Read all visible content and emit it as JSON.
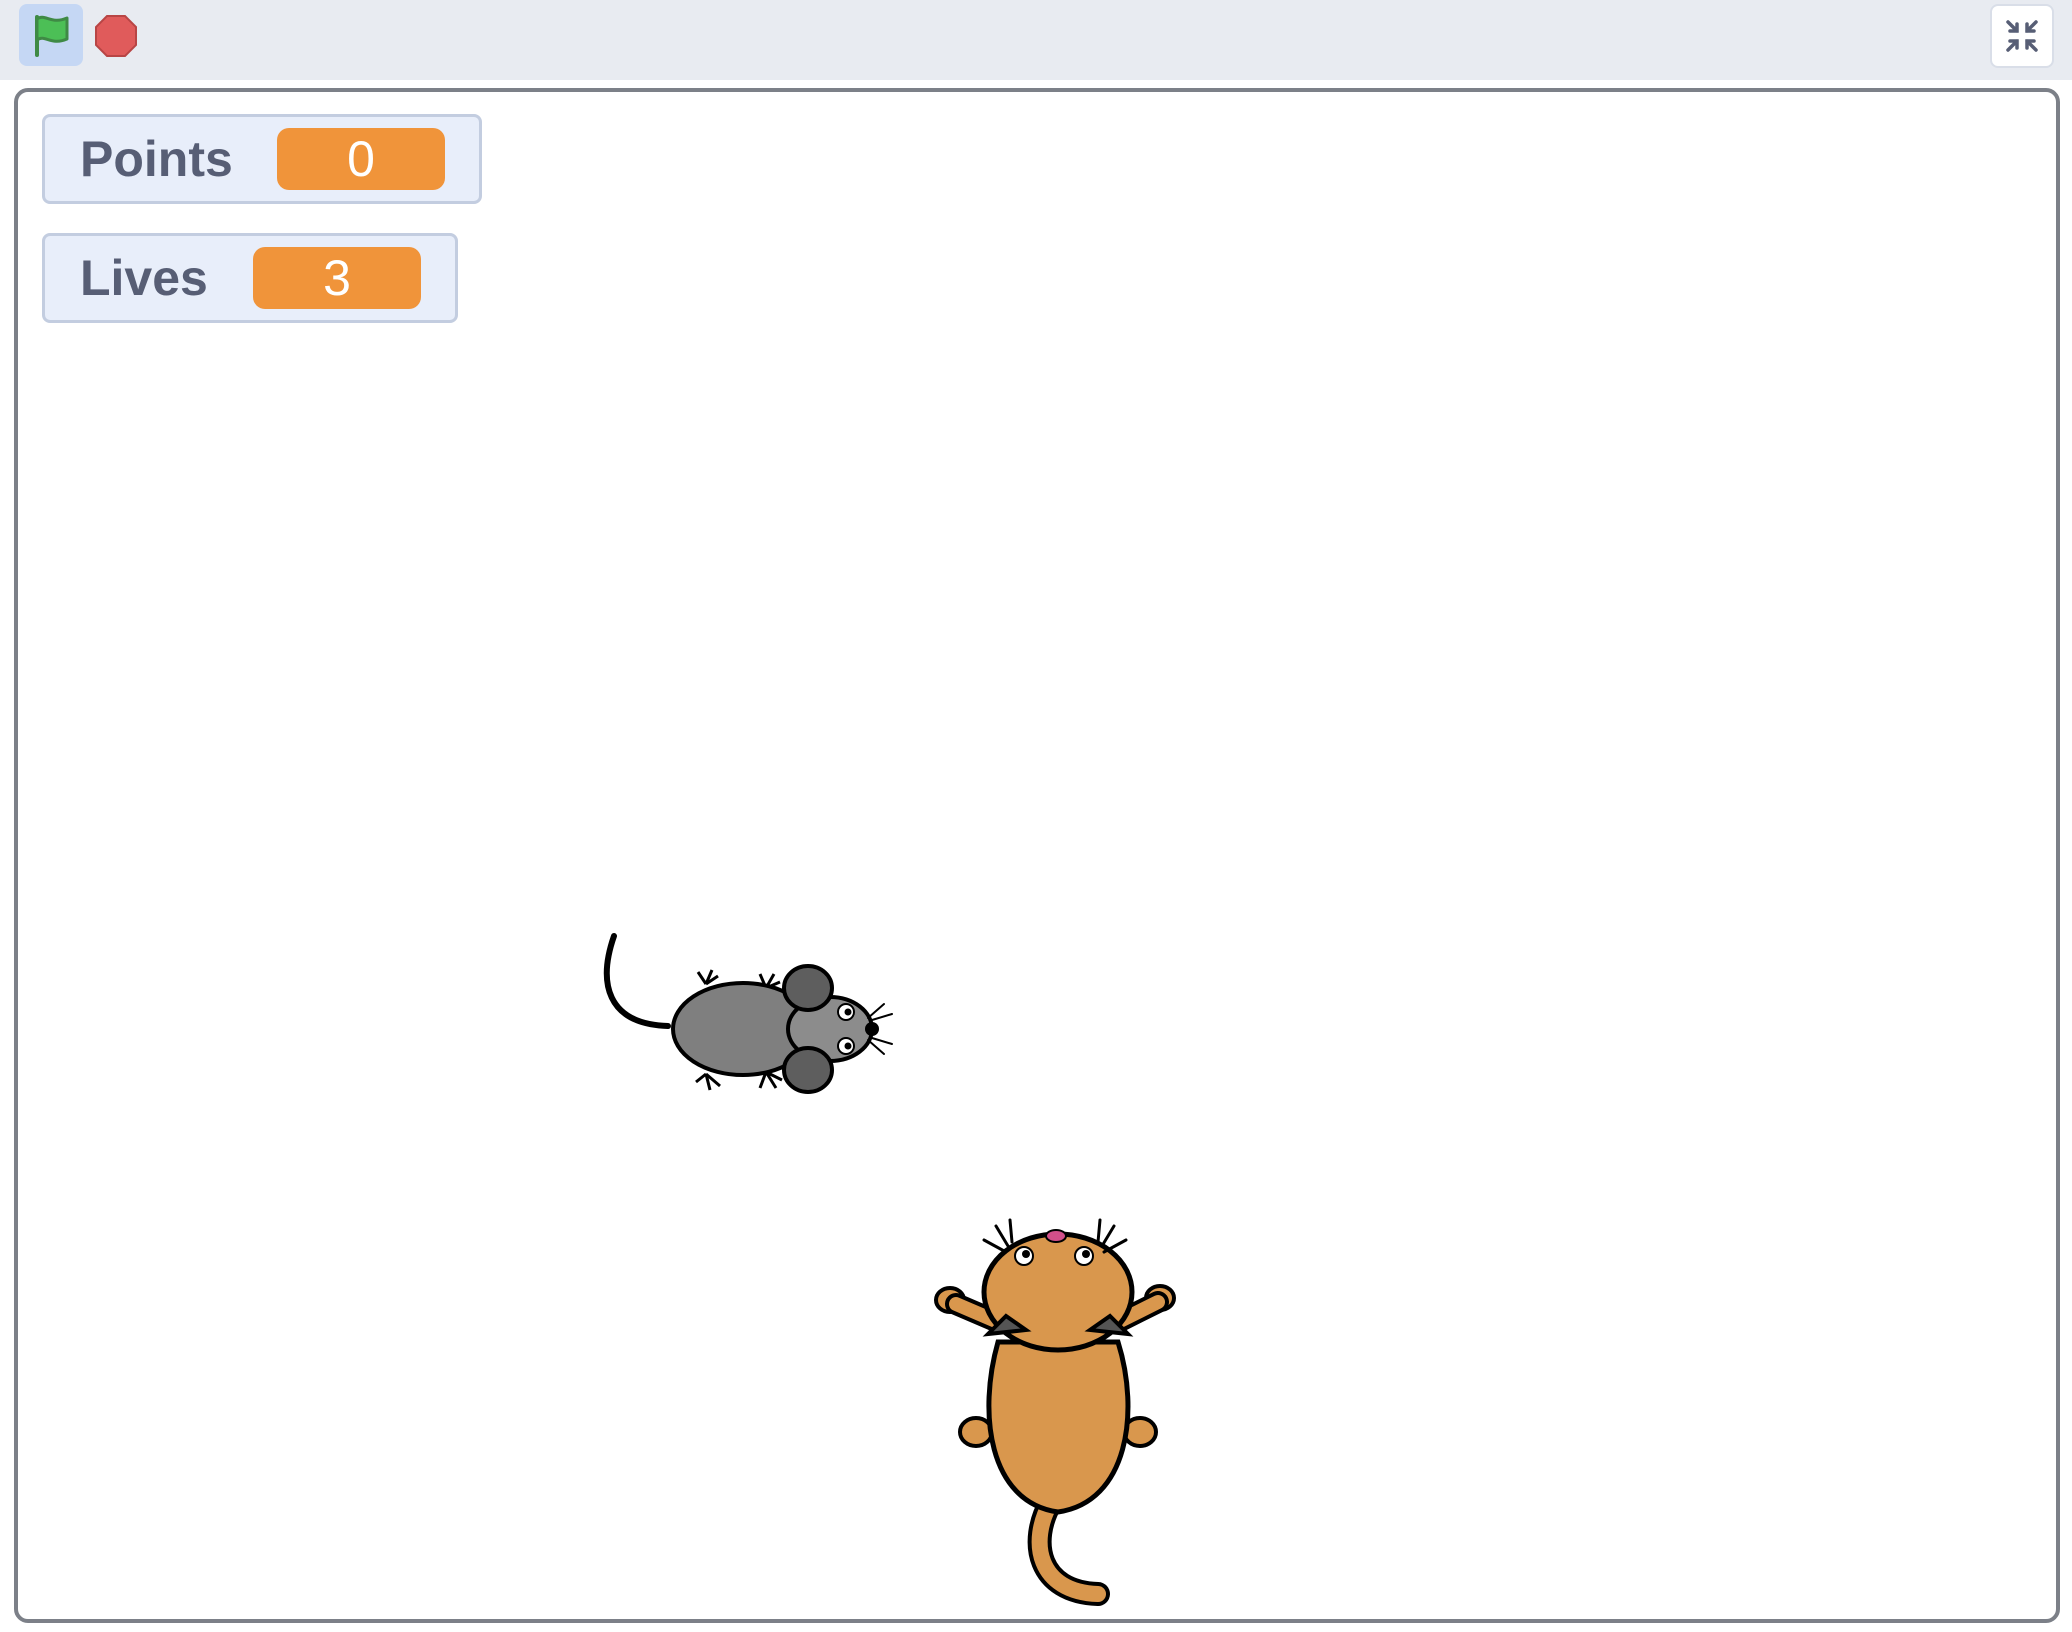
{
  "toolbar": {
    "green_flag_icon": "green-flag-icon",
    "stop_icon": "stop-sign-icon",
    "fullscreen_icon": "exit-fullscreen-icon"
  },
  "monitors": {
    "points": {
      "label": "Points",
      "value": "0"
    },
    "lives": {
      "label": "Lives",
      "value": "3"
    }
  },
  "sprites": {
    "mouse": "mouse-sprite",
    "cat": "cat-sprite"
  },
  "colors": {
    "monitor_value_bg": "#f0943a",
    "monitor_label": "#575e75",
    "flag_green": "#4cbf56",
    "stop_red": "#e05b5b",
    "cat_orange": "#d9974d",
    "mouse_grey": "#7f7f7f"
  }
}
